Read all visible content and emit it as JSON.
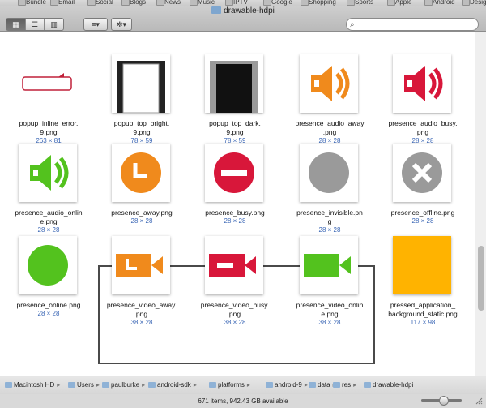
{
  "bookmarks": [
    "Bundle",
    "Email",
    "Social",
    "Blogs",
    "News",
    "Music",
    "IPTV",
    "Google",
    "Shopping",
    "Sports",
    "Apple",
    "Android",
    "Desig"
  ],
  "window": {
    "title": "drawable-hdpi"
  },
  "toolbar": {
    "search_placeholder": ""
  },
  "cut_dims": [
    "",
    ""
  ],
  "files": [
    {
      "name": "popup_inline_error.\n9.png",
      "dim": "263 × 81",
      "icon": "popup-inline-error"
    },
    {
      "name": "popup_top_bright.\n9.png",
      "dim": "78 × 59",
      "icon": "popup-top-bright"
    },
    {
      "name": "popup_top_dark.\n9.png",
      "dim": "78 × 59",
      "icon": "popup-top-dark"
    },
    {
      "name": "presence_audio_away\n.png",
      "dim": "28 × 28",
      "icon": "audio-away"
    },
    {
      "name": "presence_audio_busy.\npng",
      "dim": "28 × 28",
      "icon": "audio-busy"
    },
    {
      "name": "presence_audio_onlin\ne.png",
      "dim": "28 × 28",
      "icon": "audio-online"
    },
    {
      "name": "presence_away.png",
      "dim": "28 × 28",
      "icon": "away"
    },
    {
      "name": "presence_busy.png",
      "dim": "28 × 28",
      "icon": "busy"
    },
    {
      "name": "presence_invisible.pn\ng",
      "dim": "28 × 28",
      "icon": "invisible"
    },
    {
      "name": "presence_offline.png",
      "dim": "28 × 28",
      "icon": "offline"
    },
    {
      "name": "presence_online.png",
      "dim": "28 × 28",
      "icon": "online"
    },
    {
      "name": "presence_video_away.\npng",
      "dim": "38 × 28",
      "icon": "video-away"
    },
    {
      "name": "presence_video_busy.\npng",
      "dim": "38 × 28",
      "icon": "video-busy"
    },
    {
      "name": "presence_video_onlin\ne.png",
      "dim": "38 × 28",
      "icon": "video-online"
    },
    {
      "name": "pressed_application_\nbackground_static.png",
      "dim": "117 × 98",
      "icon": "pressed-bg"
    }
  ],
  "path_bar": [
    "Macintosh HD",
    "Users",
    "paulburke",
    "android-sdk",
    "platforms",
    "android-9",
    "data",
    "res",
    "drawable-hdpi"
  ],
  "status": {
    "text": "671 items, 942.43 GB available"
  },
  "colors": {
    "away": "#f08a1c",
    "busy": "#d8173a",
    "online": "#53c21e",
    "gray": "#9a9a9a",
    "selection": "#4a4a4a"
  }
}
